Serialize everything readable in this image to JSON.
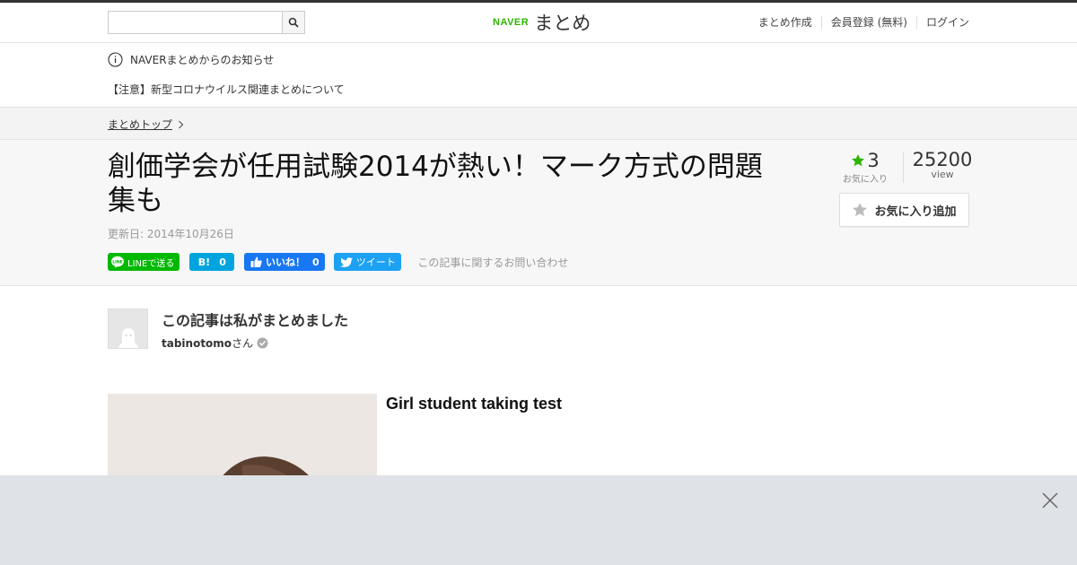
{
  "header": {
    "search_placeholder": "",
    "logo_brand": "NAVER",
    "logo_text": "まとめ",
    "nav": [
      "まとめ作成",
      "会員登録 (無料)",
      "ログイン"
    ]
  },
  "notice": {
    "heading": "NAVERまとめからのお知らせ",
    "item": "【注意】新型コロナウイルス関連まとめについて"
  },
  "breadcrumb": {
    "top": "まとめトップ"
  },
  "article": {
    "title": "創価学会が任用試験2014が熱い！マーク方式の問題集も",
    "updated": "更新日: 2014年10月26日",
    "favorites_count": "3",
    "favorites_label": "お気に入り",
    "views_count": "25200",
    "views_label": "view",
    "add_favorite_label": "お気に入り追加"
  },
  "share": {
    "line_label": "LINEで送る",
    "hatena_label": "B!",
    "hatena_count": "0",
    "fb_label": "いいね！",
    "fb_count": "0",
    "tweet_label": "ツイート",
    "inquiry_label": "この記事に関するお問い合わせ"
  },
  "author": {
    "heading": "この記事は私がまとめました",
    "name": "tabinotomo",
    "suffix": "さん"
  },
  "content": {
    "caption": "Girl student taking test"
  },
  "colors": {
    "naver_green": "#2db400",
    "line_green": "#00b900",
    "hatena_blue": "#00a4de",
    "facebook_blue": "#1877f2",
    "twitter_blue": "#1da1f2"
  }
}
